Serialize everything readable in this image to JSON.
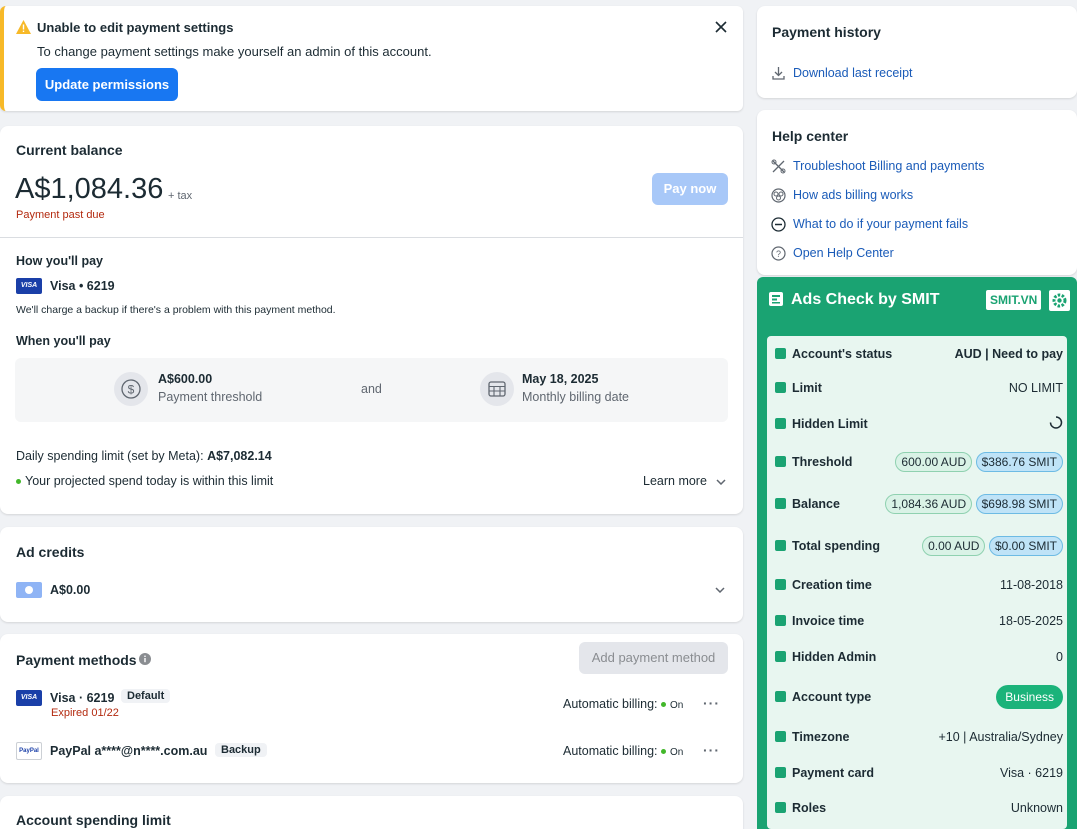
{
  "alert": {
    "title": "Unable to edit payment settings",
    "message": "To change payment settings make yourself an admin of this account.",
    "button": "Update permissions"
  },
  "balance": {
    "heading": "Current balance",
    "amount": "A$1,084.36",
    "tax": "+ tax",
    "status": "Payment past due",
    "pay_button": "Pay now",
    "how_heading": "How you'll pay",
    "card": "Visa • 6219",
    "backup_note": "We'll charge a backup if there's a problem with this payment method.",
    "when_heading": "When you'll pay",
    "threshold_value": "A$600.00",
    "threshold_label": "Payment threshold",
    "and": "and",
    "date_value": "May 18, 2025",
    "date_label": "Monthly billing date",
    "daily_prefix": "Daily spending limit (set by Meta):",
    "daily_value": "A$7,082.14",
    "projected": "Your projected spend today is within this limit",
    "learn_more": "Learn more"
  },
  "credits": {
    "heading": "Ad credits",
    "amount": "A$0.00"
  },
  "methods": {
    "heading": "Payment methods",
    "add_button": "Add payment method",
    "items": [
      {
        "name": "Visa · 6219",
        "tag": "Default",
        "sub": "Expired 01/22",
        "billing": "Automatic billing:",
        "state": "On"
      },
      {
        "name": "PayPal a****@n****.com.au",
        "tag": "Backup",
        "sub": "",
        "billing": "Automatic billing:",
        "state": "On"
      }
    ]
  },
  "spend_limit": {
    "heading": "Account spending limit"
  },
  "history": {
    "heading": "Payment history",
    "download": "Download last receipt"
  },
  "help": {
    "heading": "Help center",
    "links": [
      "Troubleshoot Billing and payments",
      "How ads billing works",
      "What to do if your payment fails",
      "Open Help Center"
    ]
  },
  "smit": {
    "title": "Ads Check by SMIT",
    "badge": "SMIT.VN",
    "rows": {
      "status_label": "Account's status",
      "status_value": "AUD | Need to pay",
      "limit_label": "Limit",
      "limit_value": "NO LIMIT",
      "hidden_limit_label": "Hidden Limit",
      "threshold_label": "Threshold",
      "threshold_aud": "600.00 AUD",
      "threshold_smit": "$386.76 SMIT",
      "balance_label": "Balance",
      "balance_aud": "1,084.36 AUD",
      "balance_smit": "$698.98 SMIT",
      "total_label": "Total spending",
      "total_aud": "0.00 AUD",
      "total_smit": "$0.00 SMIT",
      "creation_label": "Creation time",
      "creation_value": "11-08-2018",
      "invoice_label": "Invoice time",
      "invoice_value": "18-05-2025",
      "hidden_admin_label": "Hidden Admin",
      "hidden_admin_value": "0",
      "type_label": "Account type",
      "type_value": "Business",
      "tz_label": "Timezone",
      "tz_value": "+10 | Australia/Sydney",
      "card_label": "Payment card",
      "card_value": "Visa · 6219",
      "roles_label": "Roles",
      "roles_value": "Unknown"
    }
  },
  "colors": {
    "accent": "#1877f2",
    "smit_green": "#1aa372",
    "warning": "#f7b928",
    "danger": "#b32a0f"
  }
}
